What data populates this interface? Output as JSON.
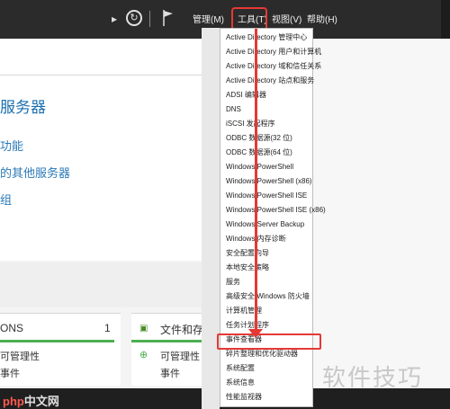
{
  "menubar": {
    "items": [
      "管理(M)",
      "工具(T)",
      "视图(V)",
      "帮助(H)"
    ]
  },
  "welcome": {
    "title": "服务器",
    "links": [
      "功能",
      "的其他服务器",
      "组"
    ]
  },
  "tiles": {
    "left": {
      "name": "ONS",
      "count": "1",
      "line1": "可管理性",
      "line2": "事件"
    },
    "right": {
      "name": "文件和存",
      "line1": "可管理性",
      "line2": "事件"
    }
  },
  "tools_menu": {
    "items": [
      "Active Directory 管理中心",
      "Active Directory 用户和计算机",
      "Active Directory 域和信任关系",
      "Active Directory 站点和服务",
      "ADSI 编辑器",
      "DNS",
      "iSCSI 发起程序",
      "ODBC 数据源(32 位)",
      "ODBC 数据源(64 位)",
      "Windows PowerShell",
      "Windows PowerShell (x86)",
      "Windows PowerShell ISE",
      "Windows PowerShell ISE (x86)",
      "Windows Server Backup",
      "Windows 内存诊断",
      "安全配置向导",
      "本地安全策略",
      "服务",
      "高级安全 Windows 防火墙",
      "计算机管理",
      "任务计划程序",
      "事件查看器",
      "碎片整理和优化驱动器",
      "系统配置",
      "系统信息",
      "性能监视器"
    ],
    "highlighted": "事件查看器"
  },
  "watermark": "软件技巧",
  "brand": {
    "prefix": "php",
    "suffix": "中文网"
  },
  "colors": {
    "highlight": "#e53935",
    "link": "#2b79b7"
  }
}
